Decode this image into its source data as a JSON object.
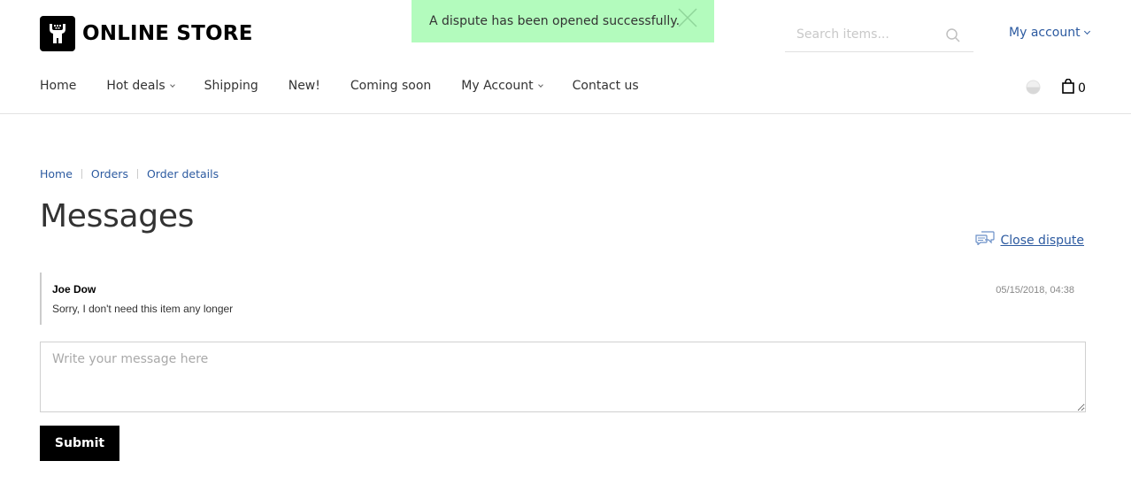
{
  "header": {
    "logo_text": "ONLINE STORE",
    "logo_icon": "store-logo-icon",
    "notification": "A dispute has been opened successfully.",
    "search": {
      "placeholder": "Search items..."
    },
    "account_label": "My account"
  },
  "nav": {
    "items": [
      {
        "label": "Home"
      },
      {
        "label": "Hot deals",
        "dropdown": true
      },
      {
        "label": "Shipping"
      },
      {
        "label": "New!"
      },
      {
        "label": "Coming soon"
      },
      {
        "label": "My Account",
        "dropdown": true
      },
      {
        "label": "Contact us"
      }
    ],
    "cart_count": "0"
  },
  "breadcrumb": [
    "Home",
    "Orders",
    "Order details"
  ],
  "page_title": "Messages",
  "close_dispute_label": "Close dispute",
  "messages": [
    {
      "author": "Joe Dow",
      "text": "Sorry, I don't need this item any longer",
      "date": "05/15/2018, 04:38"
    }
  ],
  "compose": {
    "placeholder": "Write your message here",
    "submit_label": "Submit"
  },
  "colors": {
    "link": "#2c5aa0",
    "toast_bg": "#b3fbbd",
    "button_bg": "#000000"
  }
}
